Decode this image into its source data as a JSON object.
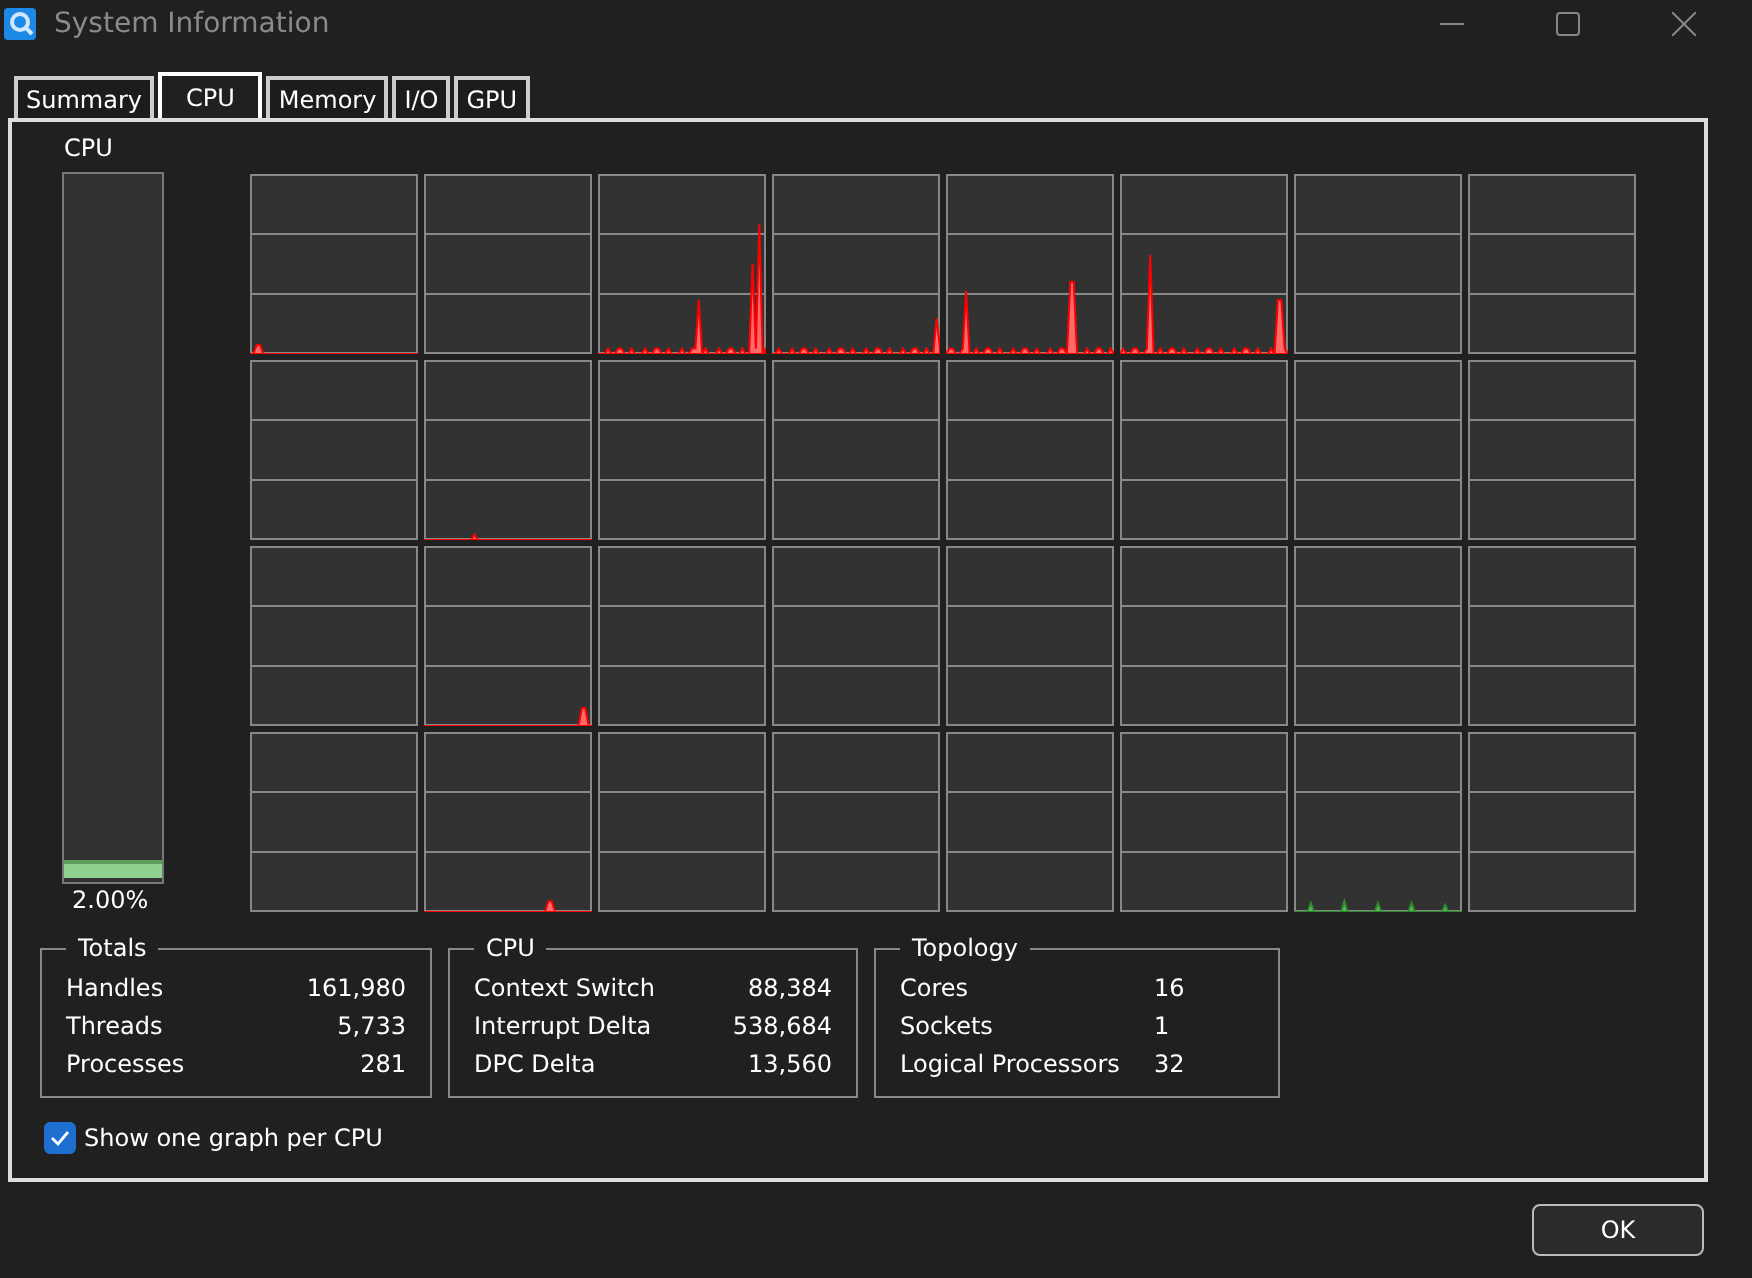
{
  "window": {
    "title": "System Information"
  },
  "tabs": [
    {
      "label": "Summary",
      "selected": false
    },
    {
      "label": "CPU",
      "selected": true
    },
    {
      "label": "Memory",
      "selected": false
    },
    {
      "label": "I/O",
      "selected": false
    },
    {
      "label": "GPU",
      "selected": false
    }
  ],
  "cpu_meter": {
    "label": "CPU",
    "level": 0.02,
    "reading": "2.00%"
  },
  "groups": [
    {
      "title": "Totals",
      "rows": [
        {
          "label": "Handles",
          "value": "161,980"
        },
        {
          "label": "Threads",
          "value": "5,733"
        },
        {
          "label": "Processes",
          "value": "281"
        }
      ]
    },
    {
      "title": "CPU",
      "rows": [
        {
          "label": "Context Switch",
          "value": "88,384"
        },
        {
          "label": "Interrupt Delta",
          "value": "538,684"
        },
        {
          "label": "DPC Delta",
          "value": "13,560"
        }
      ]
    },
    {
      "title": "Topology",
      "rows": [
        {
          "label": "Cores",
          "value": "16"
        },
        {
          "label": "Sockets",
          "value": "1"
        },
        {
          "label": "Logical Processors",
          "value": "32"
        }
      ]
    }
  ],
  "graph_option": {
    "label": "Show one graph per CPU",
    "checked": true
  },
  "buttons": [
    "OK"
  ]
}
